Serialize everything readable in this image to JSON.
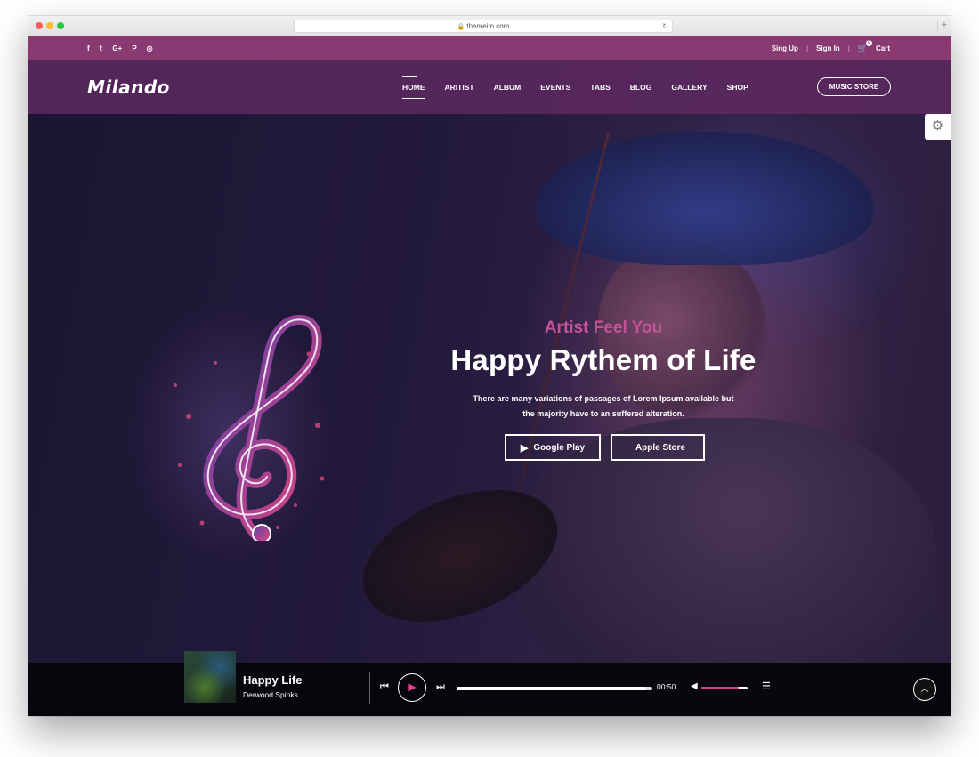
{
  "browser": {
    "url": "themeim.com",
    "reload_icon": "reload-icon",
    "new_tab": "+"
  },
  "topbar": {
    "social": [
      "f",
      "𝕥",
      "G+",
      "P",
      "◎"
    ],
    "sign_up": "Sing Up",
    "sign_in": "Sign In",
    "separator": "|",
    "cart_label": "Cart",
    "cart_count": "0"
  },
  "header": {
    "logo": "Milando",
    "nav": [
      "HOME",
      "ARITIST",
      "ALBUM",
      "EVENTS",
      "TABS",
      "BLOG",
      "GALLERY",
      "SHOP"
    ],
    "store_button": "MUSIC STORE",
    "settings_icon": "⚙"
  },
  "hero": {
    "kicker": "Artist Feel You",
    "headline": "Happy Rythem of Life",
    "description_line1": "There are many variations of passages of Lorem Ipsum available but",
    "description_line2": "the majority have to an suffered alteration.",
    "google_play": "Google Play",
    "apple_store": "Apple Store"
  },
  "player": {
    "track_title": "Happy Life",
    "artist": "Derwood Spinks",
    "time": "00:50",
    "progress": 0.97,
    "volume": 0.8,
    "prev_glyph": "⏮",
    "play_glyph": "▶",
    "next_glyph": "⏭",
    "volume_glyph": "◀",
    "playlist_glyph": "☰",
    "top_glyph": "︿"
  },
  "colors": {
    "accent": "#c45296",
    "topbar": "#8a3a72",
    "nav": "#5c2860",
    "player_accent": "#d8408a"
  }
}
